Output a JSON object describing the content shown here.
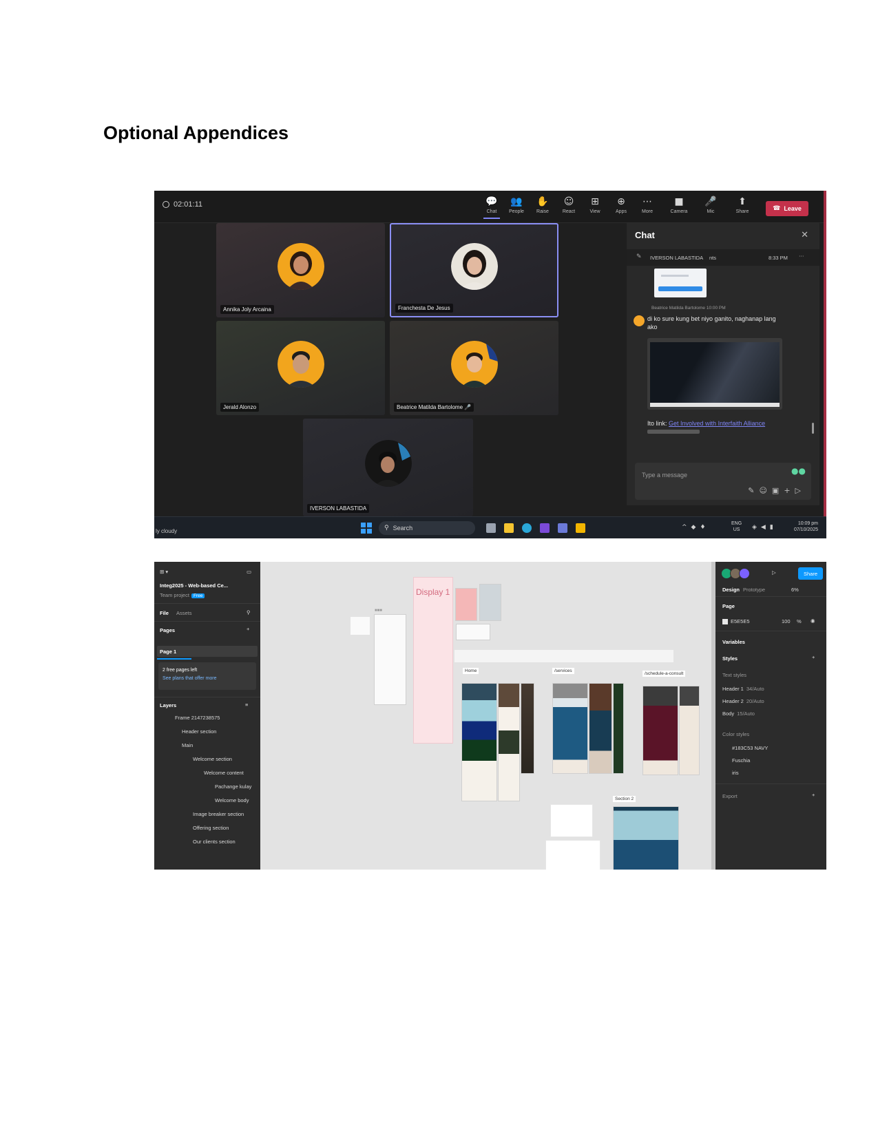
{
  "heading": "Optional Appendices",
  "teams": {
    "timer": "02:01:11",
    "toolbar": [
      {
        "label": "Chat",
        "icon": "chat-icon",
        "glyph": "💬"
      },
      {
        "label": "People",
        "icon": "people-icon",
        "glyph": "👥"
      },
      {
        "label": "Raise",
        "icon": "hand-icon",
        "glyph": "✋"
      },
      {
        "label": "React",
        "icon": "smile-icon",
        "glyph": "☺"
      },
      {
        "label": "View",
        "icon": "grid-icon",
        "glyph": "⊞"
      },
      {
        "label": "Apps",
        "icon": "apps-icon",
        "glyph": "⊕"
      },
      {
        "label": "More",
        "icon": "more-icon",
        "glyph": "⋯"
      },
      {
        "label": "Camera",
        "icon": "camera-off-icon",
        "glyph": "■"
      },
      {
        "label": "Mic",
        "icon": "mic-icon",
        "glyph": "🎤"
      },
      {
        "label": "Share",
        "icon": "share-icon",
        "glyph": "⬆"
      }
    ],
    "leave_label": "Leave",
    "participants": [
      {
        "name": "Annika Joly Arcaina"
      },
      {
        "name": "Franchesta De Jesus"
      },
      {
        "name": "Jerald Alonzo"
      },
      {
        "name": "Beatrice Matilda Bartolome"
      },
      {
        "name": "IVERSON LABASTIDA"
      }
    ],
    "chat": {
      "title": "Chat",
      "pinned_sender": "IVERSON LABASTIDA",
      "pinned_extra": "nts",
      "pinned_time": "8:33 PM",
      "message_sender": "Beatrice Matilda Bartolome 10:00 PM",
      "message_text": "di ko sure kung bet niyo ganito, naghanap lang ako",
      "link_prefix": "Ito link:",
      "link_text": "Get Involved with Interfaith Alliance",
      "compose_placeholder": "Type a message"
    },
    "taskbar": {
      "weather": "ly cloudy",
      "search": "Search",
      "lang_1": "ENG",
      "lang_2": "US",
      "time": "10:09 pm",
      "date": "07/10/2025"
    },
    "colors": {
      "leave": "#c4314b",
      "accent": "#7f85f5"
    }
  },
  "figma": {
    "file_title": "Integ2025 - Web-based Ce...",
    "team_project": "Team project",
    "plan_badge": "Free",
    "tab_file": "File",
    "tab_assets": "Assets",
    "pages_label": "Pages",
    "page_1": "Page 1",
    "notice_title": "2 free pages left",
    "notice_link": "See plans that offer more",
    "layers_label": "Layers",
    "layers": [
      "Frame 2147238575",
      "Header section",
      "Main",
      "Welcome section",
      "Welcome content",
      "Pachange kulay",
      "Welcome body",
      "Image breaker section",
      "Offering section",
      "Our clients section"
    ],
    "right": {
      "tab_design": "Design",
      "tab_prototype": "Prototype",
      "zoom": "6%",
      "share_label": "Share",
      "page_label": "Page",
      "page_color": "E5E5E5",
      "page_opacity": "100",
      "page_opacity_unit": "%",
      "variables_label": "Variables",
      "styles_label": "Styles",
      "text_styles_label": "Text styles",
      "text_styles": [
        {
          "name": "Header 1",
          "spec": "34/Auto"
        },
        {
          "name": "Header 2",
          "spec": "20/Auto"
        },
        {
          "name": "Body",
          "spec": "15/Auto"
        }
      ],
      "color_styles_label": "Color styles",
      "color_styles": [
        "#183C53 NAVY",
        "Fuschia",
        "iris"
      ],
      "export_label": "Export"
    },
    "canvas": {
      "frame_label_display": "Display 1",
      "frame_label_home": "Home",
      "frame_label_services": "/services",
      "frame_label_schedule": "/schedule-a-consult",
      "frame_label_section2": "Section 2"
    },
    "colors": {
      "share": "#0d99ff",
      "navy": "#183c53"
    }
  }
}
